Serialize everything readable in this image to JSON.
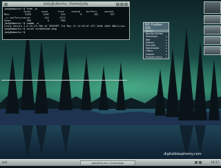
{
  "terminal": {
    "title": "jody@ubuntu: /home/jody",
    "lines": [
      {
        "kind": "prompt",
        "text": "jody@ubuntu:~$ free -m"
      },
      {
        "kind": "hdr",
        "text": "             total       used       free     shared    buffers     cached"
      },
      {
        "kind": "out",
        "text": "Mem:          2026        1482        544          0        102        927"
      },
      {
        "kind": "out",
        "text": "-/+ buffers/cache:         452       1573"
      },
      {
        "kind": "out",
        "text": "Swap:          980           0        980"
      },
      {
        "kind": "prompt",
        "text": "jody@ubuntu:~$ uname -a"
      },
      {
        "kind": "out",
        "text": "Linux ubuntu 2.6.15-23-386 #1 PREEMPT Tue May 23 14:03:07 UTC 2006 i686 GNU/Linux"
      },
      {
        "kind": "prompt",
        "text": "jody@ubuntu:~$ scrot screenshot.png"
      },
      {
        "kind": "prompt",
        "text": "jody@ubuntu:~$ "
      }
    ]
  },
  "menu": {
    "title": "GO: Fluxbox-XXX",
    "items": [
      {
        "label": "Aterm",
        "submenu": false
      },
      {
        "label": "Mozilla-Firefox",
        "submenu": false
      },
      {
        "label": "Terminals",
        "submenu": true
      },
      {
        "label": "Net",
        "submenu": true
      },
      {
        "label": "Editors",
        "submenu": true
      },
      {
        "label": "File utils",
        "submenu": true
      },
      {
        "label": "Multimedia",
        "submenu": true
      },
      {
        "label": "Office",
        "submenu": true
      },
      {
        "label": "Games",
        "submenu": true
      },
      {
        "label": "fluxbox menu",
        "submenu": true
      }
    ]
  },
  "taskbar": {
    "workspace": "one",
    "task": "jody@ubuntu: /home/jody",
    "clock": "14:17"
  },
  "watermark": "digitalblasphemy.com",
  "colors": {
    "sky_top": "#0f2a2c",
    "aurora": "#2fa37d",
    "snow": "#1a2e44"
  }
}
